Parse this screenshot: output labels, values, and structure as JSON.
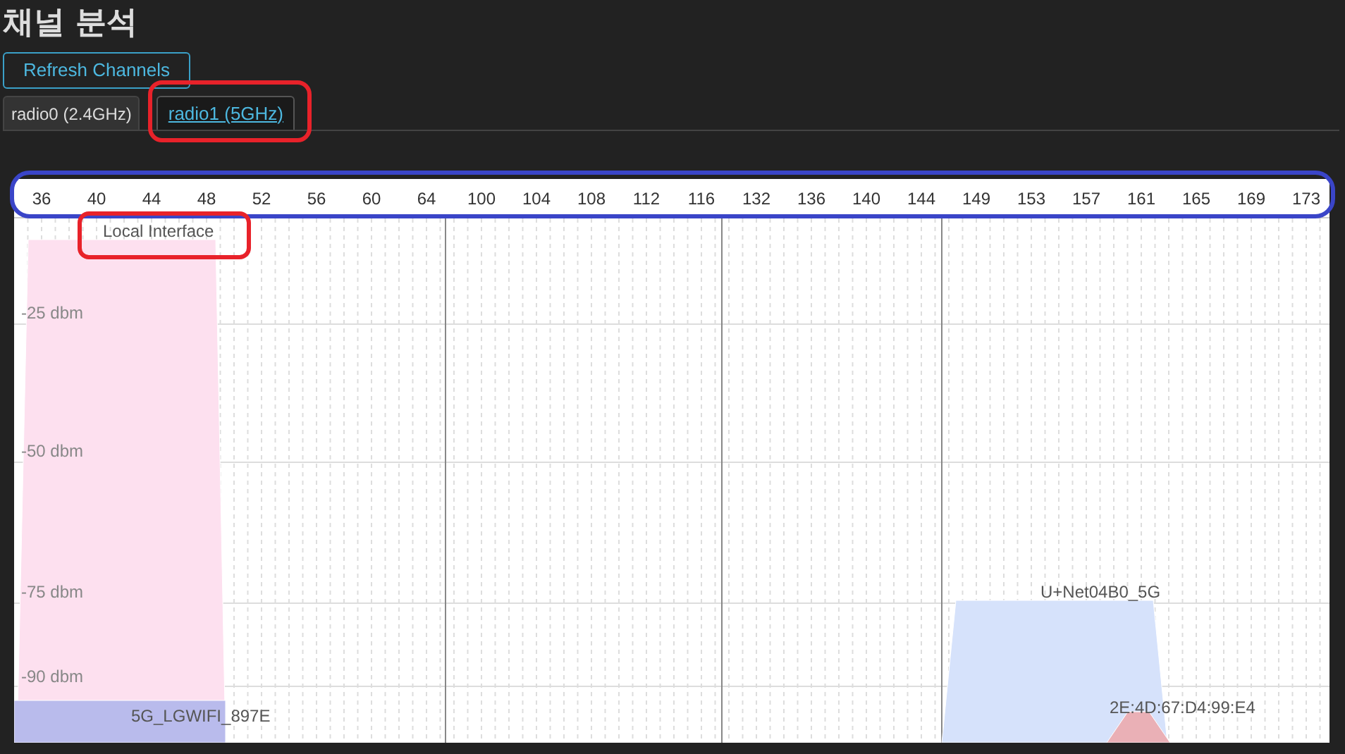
{
  "title": "채널 분석",
  "refresh_button": "Refresh Channels",
  "tabs": [
    {
      "label": "radio0 (2.4GHz)",
      "selected": false
    },
    {
      "label": "radio1 (5GHz)",
      "selected": true
    }
  ],
  "channels": [
    "36",
    "40",
    "44",
    "48",
    "52",
    "56",
    "60",
    "64",
    "100",
    "104",
    "108",
    "112",
    "116",
    "132",
    "136",
    "140",
    "144",
    "149",
    "153",
    "157",
    "161",
    "165",
    "169",
    "173"
  ],
  "dbm_labels": [
    "-25 dbm",
    "-50 dbm",
    "-75 dbm",
    "-90 dbm"
  ],
  "networks": [
    {
      "name": "Local Interface",
      "color": "#fde0ef"
    },
    {
      "name": "5G_LGWIFI_897E",
      "color": "#b9bbec"
    },
    {
      "name": "U+Net04B0_5G",
      "color": "#d6e2fb"
    },
    {
      "name": "2E:4D:67:D4:99:E4",
      "color": "#eab0b6"
    }
  ]
}
